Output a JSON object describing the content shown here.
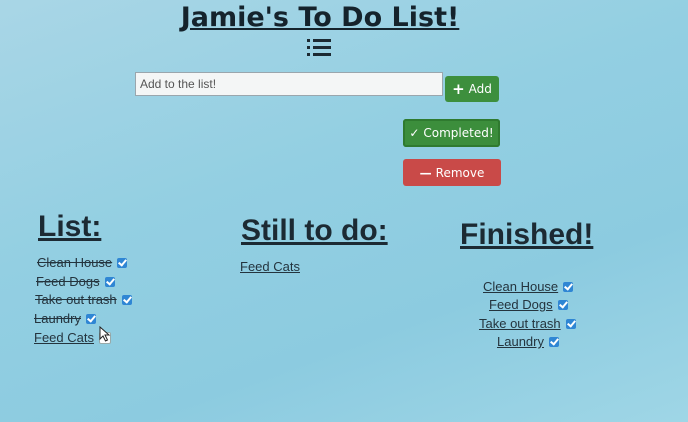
{
  "app": {
    "title": "Jamie's To Do List!"
  },
  "form": {
    "input_placeholder": "Add to the list!",
    "add_label": "Add",
    "completed_label": "Completed!",
    "remove_label": "Remove"
  },
  "columns": {
    "list": {
      "heading": "List:",
      "items": [
        {
          "label": "Clean House",
          "done": true
        },
        {
          "label": "Feed Dogs",
          "done": true
        },
        {
          "label": "Take out trash",
          "done": true
        },
        {
          "label": "Laundry",
          "done": true
        },
        {
          "label": "Feed Cats",
          "done": false
        }
      ]
    },
    "todo": {
      "heading": "Still to do:",
      "items": [
        {
          "label": "Feed Cats"
        }
      ]
    },
    "finished": {
      "heading": "Finished!",
      "items": [
        {
          "label": "Clean House",
          "done": true
        },
        {
          "label": "Feed Dogs",
          "done": true
        },
        {
          "label": "Take out trash",
          "done": true
        },
        {
          "label": "Laundry",
          "done": true
        }
      ]
    }
  },
  "colors": {
    "add": "#3d8f3d",
    "completed": "#3c8e3c",
    "remove": "#c94a48",
    "checkbox": "#2f86d4"
  }
}
